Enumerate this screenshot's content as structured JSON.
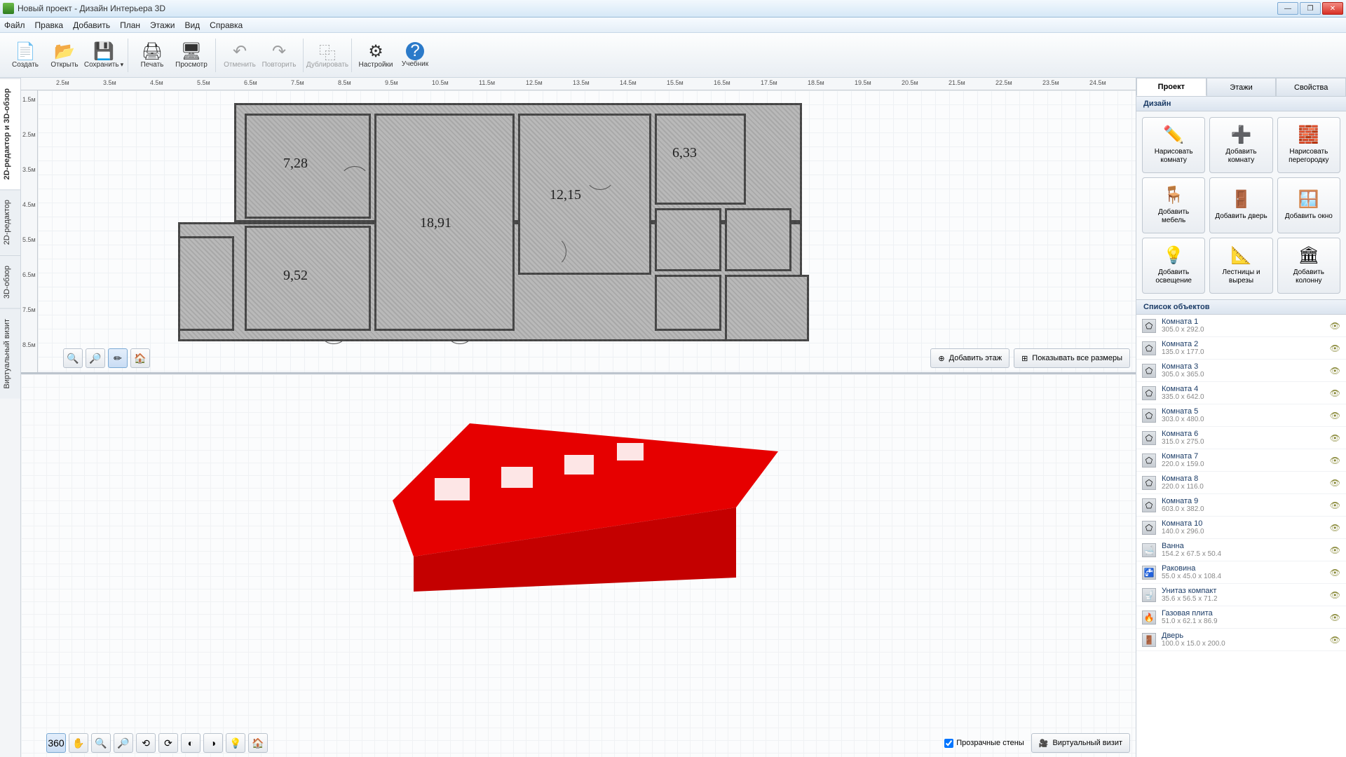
{
  "window": {
    "title": "Новый проект - Дизайн Интерьера 3D"
  },
  "menu": [
    "Файл",
    "Правка",
    "Добавить",
    "План",
    "Этажи",
    "Вид",
    "Справка"
  ],
  "toolbar": [
    {
      "id": "create",
      "label": "Создать",
      "icon": "📄"
    },
    {
      "id": "open",
      "label": "Открыть",
      "icon": "📂"
    },
    {
      "id": "save",
      "label": "Сохранить",
      "icon": "💾",
      "dropdown": true
    },
    {
      "sep": true
    },
    {
      "id": "print",
      "label": "Печать",
      "icon": "🖨"
    },
    {
      "id": "preview",
      "label": "Просмотр",
      "icon": "🖥"
    },
    {
      "sep": true
    },
    {
      "id": "undo",
      "label": "Отменить",
      "icon": "↶",
      "disabled": true
    },
    {
      "id": "redo",
      "label": "Повторить",
      "icon": "↷",
      "disabled": true
    },
    {
      "sep": true
    },
    {
      "id": "duplicate",
      "label": "Дублировать",
      "icon": "⿻",
      "disabled": true
    },
    {
      "sep": true
    },
    {
      "id": "settings",
      "label": "Настройки",
      "icon": "⚙"
    },
    {
      "id": "tutorial",
      "label": "Учебник",
      "icon": "?"
    }
  ],
  "leftTabs": [
    {
      "label": "2D-редактор и 3D-обзор",
      "active": true
    },
    {
      "label": "2D-редактор"
    },
    {
      "label": "3D-обзор"
    },
    {
      "label": "Виртуальный визит"
    }
  ],
  "rulerH": [
    "2.5м",
    "3.5м",
    "4.5м",
    "5.5м",
    "6.5м",
    "7.5м",
    "8.5м",
    "9.5м",
    "10.5м",
    "11.5м",
    "12.5м",
    "13.5м",
    "14.5м",
    "15.5м",
    "16.5м",
    "17.5м",
    "18.5м",
    "19.5м",
    "20.5м",
    "21.5м",
    "22.5м",
    "23.5м",
    "24.5м"
  ],
  "rulerV": [
    "1.5м",
    "2.5м",
    "3.5м",
    "4.5м",
    "5.5м",
    "6.5м",
    "7.5м",
    "8.5м"
  ],
  "roomLabels": {
    "r1": "7,28",
    "r2": "18,91",
    "r3": "12,15",
    "r4": "6,33",
    "r5": "9,52"
  },
  "floorBtns": {
    "addFloor": "Добавить этаж",
    "showDims": "Показывать все размеры"
  },
  "view3d": {
    "transparent": "Прозрачные стены",
    "virtual": "Виртуальный визит"
  },
  "rightTabs": [
    {
      "label": "Проект",
      "active": true
    },
    {
      "label": "Этажи"
    },
    {
      "label": "Свойства"
    }
  ],
  "designHead": "Дизайн",
  "designBtns": [
    {
      "icon": "✏️",
      "label": "Нарисовать комнату"
    },
    {
      "icon": "➕",
      "label": "Добавить комнату"
    },
    {
      "icon": "🧱",
      "label": "Нарисовать перегородку"
    },
    {
      "icon": "🪑",
      "label": "Добавить мебель"
    },
    {
      "icon": "🚪",
      "label": "Добавить дверь"
    },
    {
      "icon": "🪟",
      "label": "Добавить окно"
    },
    {
      "icon": "💡",
      "label": "Добавить освещение"
    },
    {
      "icon": "📐",
      "label": "Лестницы и вырезы"
    },
    {
      "icon": "🏛",
      "label": "Добавить колонну"
    }
  ],
  "objHead": "Список объектов",
  "objects": [
    {
      "name": "Комната 1",
      "dim": "305.0 x 292.0",
      "thumb": "⬠"
    },
    {
      "name": "Комната 2",
      "dim": "135.0 x 177.0",
      "thumb": "⬠"
    },
    {
      "name": "Комната 3",
      "dim": "305.0 x 365.0",
      "thumb": "⬠"
    },
    {
      "name": "Комната 4",
      "dim": "335.0 x 642.0",
      "thumb": "⬠"
    },
    {
      "name": "Комната 5",
      "dim": "303.0 x 480.0",
      "thumb": "⬠"
    },
    {
      "name": "Комната 6",
      "dim": "315.0 x 275.0",
      "thumb": "⬠"
    },
    {
      "name": "Комната 7",
      "dim": "220.0 x 159.0",
      "thumb": "⬠"
    },
    {
      "name": "Комната 8",
      "dim": "220.0 x 116.0",
      "thumb": "⬠"
    },
    {
      "name": "Комната 9",
      "dim": "603.0 x 382.0",
      "thumb": "⬠"
    },
    {
      "name": "Комната 10",
      "dim": "140.0 x 296.0",
      "thumb": "⬠"
    },
    {
      "name": "Ванна",
      "dim": "154.2 x 67.5 x 50.4",
      "thumb": "🛁"
    },
    {
      "name": "Раковина",
      "dim": "55.0 x 45.0 x 108.4",
      "thumb": "🚰"
    },
    {
      "name": "Унитаз компакт",
      "dim": "35.6 x 56.5 x 71.2",
      "thumb": "🚽"
    },
    {
      "name": "Газовая плита",
      "dim": "51.0 x 62.1 x 86.9",
      "thumb": "🔥"
    },
    {
      "name": "Дверь",
      "dim": "100.0 x 15.0 x 200.0",
      "thumb": "🚪"
    }
  ]
}
